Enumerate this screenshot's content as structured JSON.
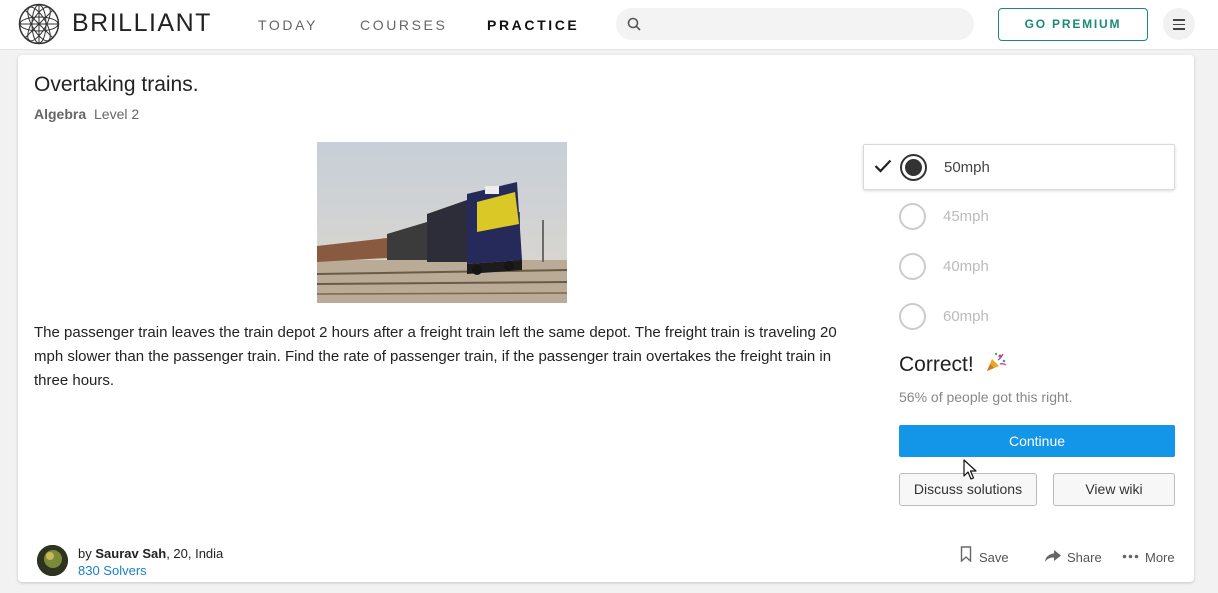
{
  "nav": {
    "brand": "BRILLIANT",
    "links": [
      "TODAY",
      "COURSES",
      "PRACTICE"
    ],
    "active_link": "PRACTICE",
    "search_placeholder": "",
    "premium_label": "GO PREMIUM"
  },
  "problem": {
    "title": "Overtaking trains.",
    "topic": "Algebra",
    "level": "Level 2",
    "text": "The passenger train leaves the train depot 2 hours after a freight train left the same depot. The freight train is traveling 20 mph slower than the passenger train. Find the rate of passenger train, if the passenger train overtakes the freight train in three hours."
  },
  "answers": {
    "options": [
      "50mph",
      "45mph",
      "40mph",
      "60mph"
    ],
    "selected": "50mph"
  },
  "result": {
    "heading": "Correct!",
    "stat": "56% of people got this right.",
    "continue_label": "Continue",
    "discuss_label": "Discuss solutions",
    "wiki_label": "View wiki"
  },
  "author": {
    "prefix": "by",
    "name": "Saurav Sah",
    "details": ", 20, India",
    "solvers": "830 Solvers"
  },
  "actions": {
    "save": "Save",
    "share": "Share",
    "more": "More"
  },
  "colors": {
    "accent_teal": "#1a8a7a",
    "continue_blue": "#1395e8",
    "link_blue": "#1a7fc4"
  }
}
